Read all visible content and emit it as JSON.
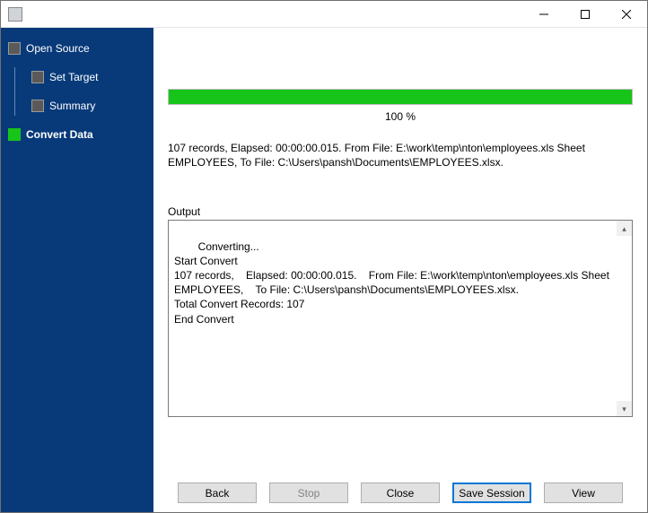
{
  "titlebar": {
    "title": ""
  },
  "sidebar": {
    "items": [
      {
        "label": "Open Source"
      },
      {
        "label": "Set Target"
      },
      {
        "label": "Summary"
      },
      {
        "label": "Convert Data"
      }
    ]
  },
  "progress": {
    "percent_label": "100 %"
  },
  "summary": "107 records,    Elapsed: 00:00:00.015.    From File: E:\\work\\temp\\nton\\employees.xls Sheet EMPLOYEES,    To File: C:\\Users\\pansh\\Documents\\EMPLOYEES.xlsx.",
  "output": {
    "label": "Output",
    "text": "Converting...\nStart Convert\n107 records,    Elapsed: 00:00:00.015.    From File: E:\\work\\temp\\nton\\employees.xls Sheet EMPLOYEES,    To File: C:\\Users\\pansh\\Documents\\EMPLOYEES.xlsx.\nTotal Convert Records: 107\nEnd Convert"
  },
  "buttons": {
    "back": "Back",
    "stop": "Stop",
    "close": "Close",
    "save_session": "Save Session",
    "view": "View"
  }
}
